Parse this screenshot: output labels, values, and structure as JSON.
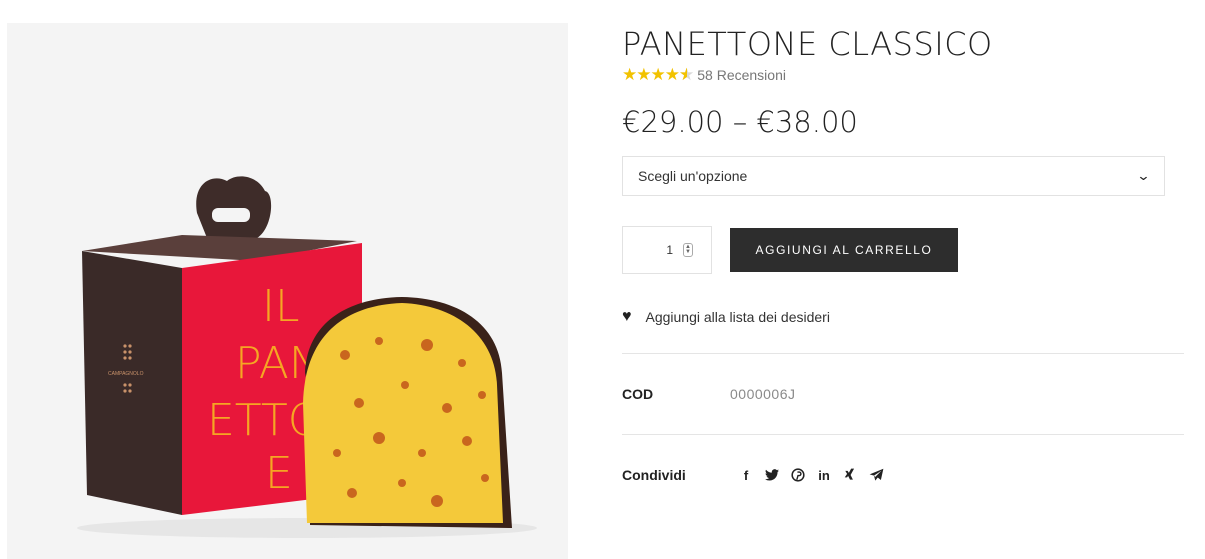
{
  "product": {
    "title": "PANETTONE CLASSICO",
    "rating": 4.5,
    "reviews_label": "58 Recensioni",
    "price": "€29.00 – €38.00",
    "option_placeholder": "Scegli un'opzione",
    "quantity": "1",
    "add_to_cart_label": "AGGIUNGI AL CARRELLO",
    "wishlist_label": "Aggiungi alla lista dei desideri",
    "sku_label": "COD",
    "sku_value": "0000006J",
    "share_label": "Condividi"
  },
  "image": {
    "box_text": [
      "IL",
      "PAN",
      "ETTO",
      "E"
    ],
    "brand_text": "CAMPAGNOLO",
    "icons": [
      "box-image",
      "panettone-slice-image"
    ]
  },
  "icons": {
    "stars": "star-icon",
    "chevron": "chevron-down-icon",
    "heart": "heart-icon",
    "social": [
      "facebook-icon",
      "twitter-icon",
      "pinterest-icon",
      "linkedin-icon",
      "xing-icon",
      "telegram-icon"
    ]
  },
  "colors": {
    "star": "#f2c200",
    "button_bg": "#2d2d2d",
    "box_red": "#e8173a",
    "box_brown": "#3a2a28"
  }
}
